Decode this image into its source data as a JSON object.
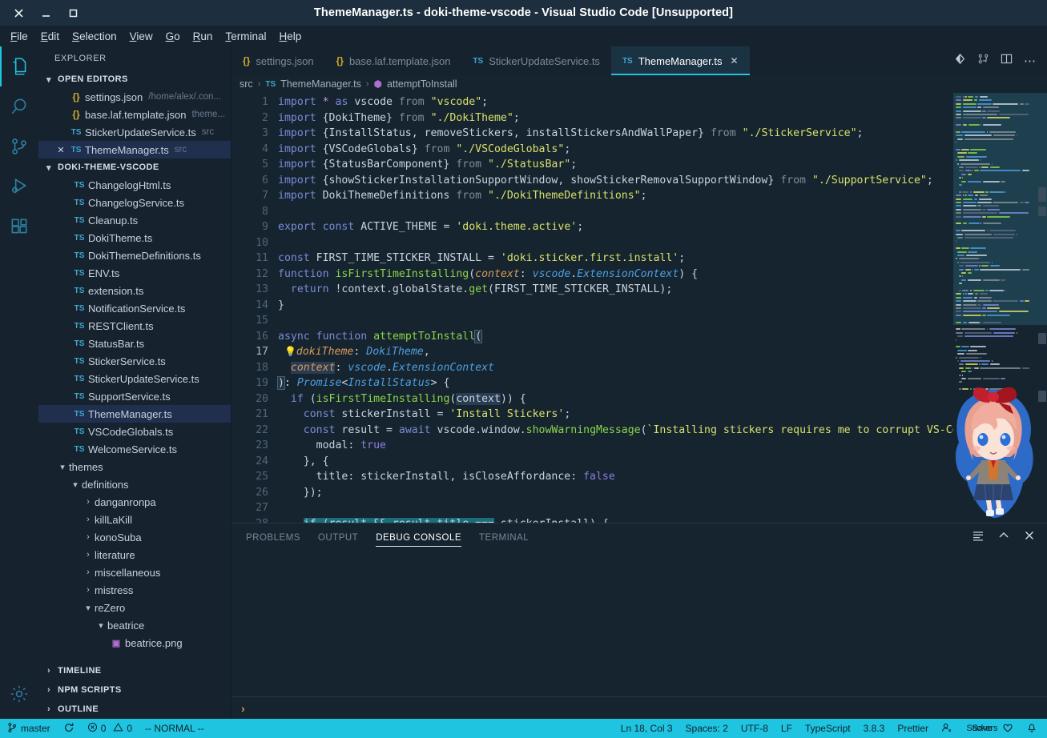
{
  "window": {
    "title": "ThemeManager.ts - doki-theme-vscode - Visual Studio Code [Unsupported]",
    "close_icon": "close-icon",
    "minimize_icon": "minimize-icon",
    "maximize_icon": "maximize-icon"
  },
  "menubar": [
    {
      "label": "File",
      "mnemonic": "F",
      "rest": "ile"
    },
    {
      "label": "Edit",
      "mnemonic": "E",
      "rest": "dit"
    },
    {
      "label": "Selection",
      "mnemonic": "S",
      "rest": "election"
    },
    {
      "label": "View",
      "mnemonic": "V",
      "rest": "iew"
    },
    {
      "label": "Go",
      "mnemonic": "G",
      "rest": "o"
    },
    {
      "label": "Run",
      "mnemonic": "R",
      "rest": "un"
    },
    {
      "label": "Terminal",
      "mnemonic": "T",
      "rest": "erminal"
    },
    {
      "label": "Help",
      "mnemonic": "H",
      "rest": "elp"
    }
  ],
  "activitybar": [
    {
      "name": "explorer-icon",
      "active": true
    },
    {
      "name": "search-icon",
      "active": false
    },
    {
      "name": "source-control-icon",
      "active": false
    },
    {
      "name": "run-debug-icon",
      "active": false
    },
    {
      "name": "extensions-icon",
      "active": false
    },
    {
      "name": "settings-gear-icon",
      "active": false
    }
  ],
  "sidebar": {
    "title": "EXPLORER",
    "open_editors": {
      "label": "OPEN EDITORS",
      "items": [
        {
          "icon": "json",
          "name": "settings.json",
          "dim": "/home/alex/.con...",
          "selected": false,
          "dirty": false
        },
        {
          "icon": "json",
          "name": "base.laf.template.json",
          "dim": "theme...",
          "selected": false,
          "dirty": false
        },
        {
          "icon": "ts",
          "name": "StickerUpdateService.ts",
          "dim": "src",
          "selected": false,
          "dirty": false
        },
        {
          "icon": "ts",
          "name": "ThemeManager.ts",
          "dim": "src",
          "selected": true,
          "dirty": true
        }
      ]
    },
    "project": {
      "label": "DOKI-THEME-VSCODE",
      "files": [
        {
          "icon": "ts",
          "name": "ChangelogHtml.ts",
          "indent": 1,
          "selected": false
        },
        {
          "icon": "ts",
          "name": "ChangelogService.ts",
          "indent": 1,
          "selected": false
        },
        {
          "icon": "ts",
          "name": "Cleanup.ts",
          "indent": 1,
          "selected": false
        },
        {
          "icon": "ts",
          "name": "DokiTheme.ts",
          "indent": 1,
          "selected": false
        },
        {
          "icon": "ts",
          "name": "DokiThemeDefinitions.ts",
          "indent": 1,
          "selected": false
        },
        {
          "icon": "ts",
          "name": "ENV.ts",
          "indent": 1,
          "selected": false
        },
        {
          "icon": "ts",
          "name": "extension.ts",
          "indent": 1,
          "selected": false
        },
        {
          "icon": "ts",
          "name": "NotificationService.ts",
          "indent": 1,
          "selected": false
        },
        {
          "icon": "ts",
          "name": "RESTClient.ts",
          "indent": 1,
          "selected": false
        },
        {
          "icon": "ts",
          "name": "StatusBar.ts",
          "indent": 1,
          "selected": false
        },
        {
          "icon": "ts",
          "name": "StickerService.ts",
          "indent": 1,
          "selected": false
        },
        {
          "icon": "ts",
          "name": "StickerUpdateService.ts",
          "indent": 1,
          "selected": false
        },
        {
          "icon": "ts",
          "name": "SupportService.ts",
          "indent": 1,
          "selected": false
        },
        {
          "icon": "ts",
          "name": "ThemeManager.ts",
          "indent": 1,
          "selected": true
        },
        {
          "icon": "ts",
          "name": "VSCodeGlobals.ts",
          "indent": 1,
          "selected": false
        },
        {
          "icon": "ts",
          "name": "WelcomeService.ts",
          "indent": 1,
          "selected": false
        },
        {
          "icon": "folder-open",
          "name": "themes",
          "indent": 0,
          "selected": false
        },
        {
          "icon": "folder-open",
          "name": "definitions",
          "indent": 1,
          "selected": false
        },
        {
          "icon": "folder-closed",
          "name": "danganronpa",
          "indent": 2,
          "selected": false
        },
        {
          "icon": "folder-closed",
          "name": "killLaKill",
          "indent": 2,
          "selected": false
        },
        {
          "icon": "folder-closed",
          "name": "konoSuba",
          "indent": 2,
          "selected": false
        },
        {
          "icon": "folder-closed",
          "name": "literature",
          "indent": 2,
          "selected": false
        },
        {
          "icon": "folder-closed",
          "name": "miscellaneous",
          "indent": 2,
          "selected": false
        },
        {
          "icon": "folder-closed",
          "name": "mistress",
          "indent": 2,
          "selected": false
        },
        {
          "icon": "folder-open",
          "name": "reZero",
          "indent": 2,
          "selected": false
        },
        {
          "icon": "folder-open",
          "name": "beatrice",
          "indent": 3,
          "selected": false
        },
        {
          "icon": "png",
          "name": "beatrice.png",
          "indent": 4,
          "selected": false
        }
      ]
    },
    "bottom_sections": [
      {
        "label": "TIMELINE"
      },
      {
        "label": "NPM SCRIPTS"
      },
      {
        "label": "OUTLINE"
      }
    ]
  },
  "tabs": [
    {
      "icon": "json",
      "label": "settings.json",
      "active": false,
      "closable": false
    },
    {
      "icon": "json",
      "label": "base.laf.template.json",
      "active": false,
      "closable": false
    },
    {
      "icon": "ts",
      "label": "StickerUpdateService.ts",
      "active": false,
      "closable": false
    },
    {
      "icon": "ts",
      "label": "ThemeManager.ts",
      "active": true,
      "closable": true,
      "close_label": "✕"
    }
  ],
  "tab_actions": [
    {
      "name": "source-control-diff-icon"
    },
    {
      "name": "split-compare-icon"
    },
    {
      "name": "split-editor-icon"
    },
    {
      "name": "more-actions-icon"
    }
  ],
  "breadcrumbs": [
    {
      "type": "text",
      "label": "src"
    },
    {
      "type": "sep",
      "label": "›"
    },
    {
      "type": "file",
      "icon": "ts",
      "label": "ThemeManager.ts"
    },
    {
      "type": "sep",
      "label": "›"
    },
    {
      "type": "symbol",
      "icon": "method",
      "label": "attemptToInstall"
    }
  ],
  "code_lines": [
    {
      "n": 1,
      "text": "import * as vscode from \"vscode\";"
    },
    {
      "n": 2,
      "text": "import {DokiTheme} from \"./DokiTheme\";"
    },
    {
      "n": 3,
      "text": "import {InstallStatus, removeStickers, installStickersAndWallPaper} from \"./StickerService\";"
    },
    {
      "n": 4,
      "text": "import {VSCodeGlobals} from \"./VSCodeGlobals\";"
    },
    {
      "n": 5,
      "text": "import {StatusBarComponent} from \"./StatusBar\";"
    },
    {
      "n": 6,
      "text": "import {showStickerInstallationSupportWindow, showStickerRemovalSupportWindow} from \"./SupportService\";"
    },
    {
      "n": 7,
      "text": "import DokiThemeDefinitions from \"./DokiThemeDefinitions\";"
    },
    {
      "n": 8,
      "text": ""
    },
    {
      "n": 9,
      "text": "export const ACTIVE_THEME = 'doki.theme.active';"
    },
    {
      "n": 10,
      "text": ""
    },
    {
      "n": 11,
      "text": "const FIRST_TIME_STICKER_INSTALL = 'doki.sticker.first.install';"
    },
    {
      "n": 12,
      "text": "function isFirstTimeInstalling(context: vscode.ExtensionContext) {"
    },
    {
      "n": 13,
      "text": "  return !context.globalState.get(FIRST_TIME_STICKER_INSTALL);"
    },
    {
      "n": 14,
      "text": "}"
    },
    {
      "n": 15,
      "text": ""
    },
    {
      "n": 16,
      "text": "async function attemptToInstall("
    },
    {
      "n": 17,
      "text": "  dokiTheme: DokiTheme,"
    },
    {
      "n": 18,
      "text": "  context: vscode.ExtensionContext"
    },
    {
      "n": 19,
      "text": "): Promise<InstallStatus> {"
    },
    {
      "n": 20,
      "text": "  if (isFirstTimeInstalling(context)) {"
    },
    {
      "n": 21,
      "text": "    const stickerInstall = 'Install Stickers';"
    },
    {
      "n": 22,
      "text": "    const result = await vscode.window.showWarningMessage(`Installing stickers requires me to corrupt VS-Co"
    },
    {
      "n": 23,
      "text": "      modal: true"
    },
    {
      "n": 24,
      "text": "    }, {"
    },
    {
      "n": 25,
      "text": "      title: stickerInstall, isCloseAffordance: false"
    },
    {
      "n": 26,
      "text": "    });"
    },
    {
      "n": 27,
      "text": ""
    },
    {
      "n": 28,
      "text": "    if (result && result.title === stickerInstall) {"
    }
  ],
  "panel": {
    "tabs": [
      {
        "label": "PROBLEMS",
        "active": false
      },
      {
        "label": "OUTPUT",
        "active": false
      },
      {
        "label": "DEBUG CONSOLE",
        "active": true
      },
      {
        "label": "TERMINAL",
        "active": false
      }
    ],
    "actions": [
      {
        "name": "clear-console-icon"
      },
      {
        "name": "chevron-up-icon"
      },
      {
        "name": "close-panel-icon"
      }
    ],
    "prompt": "›",
    "input_value": ""
  },
  "statusbar": {
    "left": [
      {
        "name": "branch",
        "icon": "source-control-branch-icon",
        "label": "master"
      },
      {
        "name": "sync",
        "icon": "sync-icon",
        "label": ""
      },
      {
        "name": "problems",
        "icon": "error-warning-icon",
        "label": "0  0",
        "errors": "0",
        "warnings": "0"
      },
      {
        "name": "vim-mode",
        "icon": "",
        "label": "-- NORMAL --"
      }
    ],
    "right": [
      {
        "name": "cursor-position",
        "label": "Ln 18, Col 3"
      },
      {
        "name": "indentation",
        "label": "Spaces: 2"
      },
      {
        "name": "encoding",
        "label": "UTF-8"
      },
      {
        "name": "eol",
        "label": "LF"
      },
      {
        "name": "language-mode",
        "label": "TypeScript"
      },
      {
        "name": "ts-version",
        "label": "3.8.3"
      },
      {
        "name": "formatter",
        "label": "Prettier"
      },
      {
        "name": "live-share",
        "icon": "live-share-icon",
        "label": ""
      },
      {
        "name": "doki-overlap",
        "label_a": "Stickers",
        "label_b": "Save",
        "icon": "heart-icon"
      },
      {
        "name": "notifications",
        "icon": "bell-icon",
        "label": ""
      }
    ],
    "accent": "#1fc4e0"
  },
  "colors": {
    "accent": "#1fc4e0",
    "titlebar_bg": "#1d2f3e",
    "sidebar_bg": "#16232f",
    "editor_bg": "#16242f",
    "selection_bg": "#1f2f4d",
    "tab_active_bg": "#1b3243"
  }
}
